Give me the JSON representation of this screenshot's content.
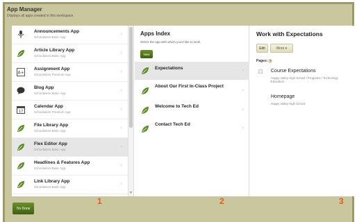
{
  "header": {
    "title": "App Manager",
    "subtitle": "Displays all apps created in this workspace."
  },
  "apps": [
    {
      "name": "Announcements App",
      "plan": "Schoolwires Basic App",
      "icon": "microphone-icon"
    },
    {
      "name": "Article Library App",
      "plan": "Schoolwires Basic App",
      "icon": "leaf-icon"
    },
    {
      "name": "Assignment App",
      "plan": "Schoolwires Premium App",
      "icon": "grade-a-plus-icon"
    },
    {
      "name": "Blog App",
      "plan": "Schoolwires Basic App",
      "icon": "speech-bubble-icon"
    },
    {
      "name": "Calendar App",
      "plan": "Schoolwires Premium App",
      "icon": "calendar-icon"
    },
    {
      "name": "File Library App",
      "plan": "Schoolwires Basic App",
      "icon": "leaf-icon"
    },
    {
      "name": "Flex Editor App",
      "plan": "Schoolwires Basic App",
      "icon": "leaf-icon"
    },
    {
      "name": "Headlines & Features App",
      "plan": "Schoolwires Basic App",
      "icon": "leaf-icon"
    },
    {
      "name": "Link Library App",
      "plan": "Schoolwires Basic App",
      "icon": "leaf-icon"
    }
  ],
  "apps_index": {
    "title": "Apps Index",
    "description": "Select the app with which you'd like to work.",
    "new_label": "New",
    "items": [
      {
        "name": "Expectations"
      },
      {
        "name": "About Our First In-Class Project"
      },
      {
        "name": "Welcome to Tech Ed"
      },
      {
        "name": "Contact Tech Ed"
      }
    ]
  },
  "work_with": {
    "title": "Work with Expectations",
    "edit_label": "Edit",
    "more_label": "More ▾",
    "pages_label": "Pages:",
    "help_glyph": "?",
    "pages": [
      {
        "title": "Course Expectations",
        "path": "Happy Valley High School / Programs / Technology Education"
      },
      {
        "title": "Homepage",
        "path": "Happy Valley High School"
      }
    ]
  },
  "footer": {
    "done_label": "I'm Done"
  },
  "callouts": [
    "1",
    "2",
    "3"
  ],
  "colors": {
    "frame_bg": "#c9c79e",
    "accent_green": "#4a6e16",
    "callout_orange": "#e85a18"
  }
}
